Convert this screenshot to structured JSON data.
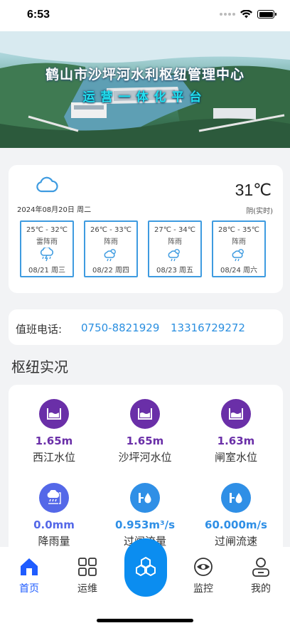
{
  "status": {
    "time": "6:53"
  },
  "banner": {
    "title": "鹤山市沙坪河水利枢纽管理中心",
    "subtitle": "运营一体化平台"
  },
  "weather": {
    "icon": "cloud-icon",
    "date": "2024年08月20日 周二",
    "temperature": "31℃",
    "condition": "阴(实时)",
    "forecast": [
      {
        "temp": "25℃ - 32℃",
        "cond": "雷阵雨",
        "icon": "thunder-rain-icon",
        "date": "08/21 周三"
      },
      {
        "temp": "26℃ - 33℃",
        "cond": "阵雨",
        "icon": "shower-icon",
        "date": "08/22 周四"
      },
      {
        "temp": "27℃ - 34℃",
        "cond": "阵雨",
        "icon": "shower-icon",
        "date": "08/23 周五"
      },
      {
        "temp": "28℃ - 35℃",
        "cond": "阵雨",
        "icon": "shower-icon",
        "date": "08/24 周六"
      }
    ]
  },
  "duty": {
    "label": "值班电话:",
    "phone1": "0750-8821929",
    "phone2": "13316729272"
  },
  "hub": {
    "title": "枢纽实况",
    "items": [
      {
        "value": "1.65m",
        "label": "西江水位",
        "icon": "water-level-icon",
        "color": "#6a2fa8"
      },
      {
        "value": "1.65m",
        "label": "沙坪河水位",
        "icon": "water-level-icon",
        "color": "#6a2fa8"
      },
      {
        "value": "1.63m",
        "label": "闸室水位",
        "icon": "water-level-icon",
        "color": "#6a2fa8"
      },
      {
        "value": "0.0mm",
        "label": "降雨量",
        "icon": "rain-gauge-icon",
        "color": "#5468e8"
      },
      {
        "value": "0.953m³/s",
        "label": "过闸流量",
        "icon": "flow-meter-icon",
        "color": "#2f8fe6"
      },
      {
        "value": "60.000m/s",
        "label": "过闸流速",
        "icon": "flow-meter-icon",
        "color": "#2f8fe6"
      }
    ]
  },
  "tabbar": {
    "items": [
      {
        "label": "首页",
        "icon": "home-icon",
        "active": true
      },
      {
        "label": "运维",
        "icon": "grid-icon",
        "active": false
      },
      {
        "label": "",
        "icon": "hexagon-icon",
        "active": false
      },
      {
        "label": "监控",
        "icon": "eye-icon",
        "active": false
      },
      {
        "label": "我的",
        "icon": "user-icon",
        "active": false
      }
    ]
  },
  "colors": {
    "accent": "#2b8fe0",
    "tab_active": "#1f5cff",
    "center_button": "#0b8df0"
  }
}
